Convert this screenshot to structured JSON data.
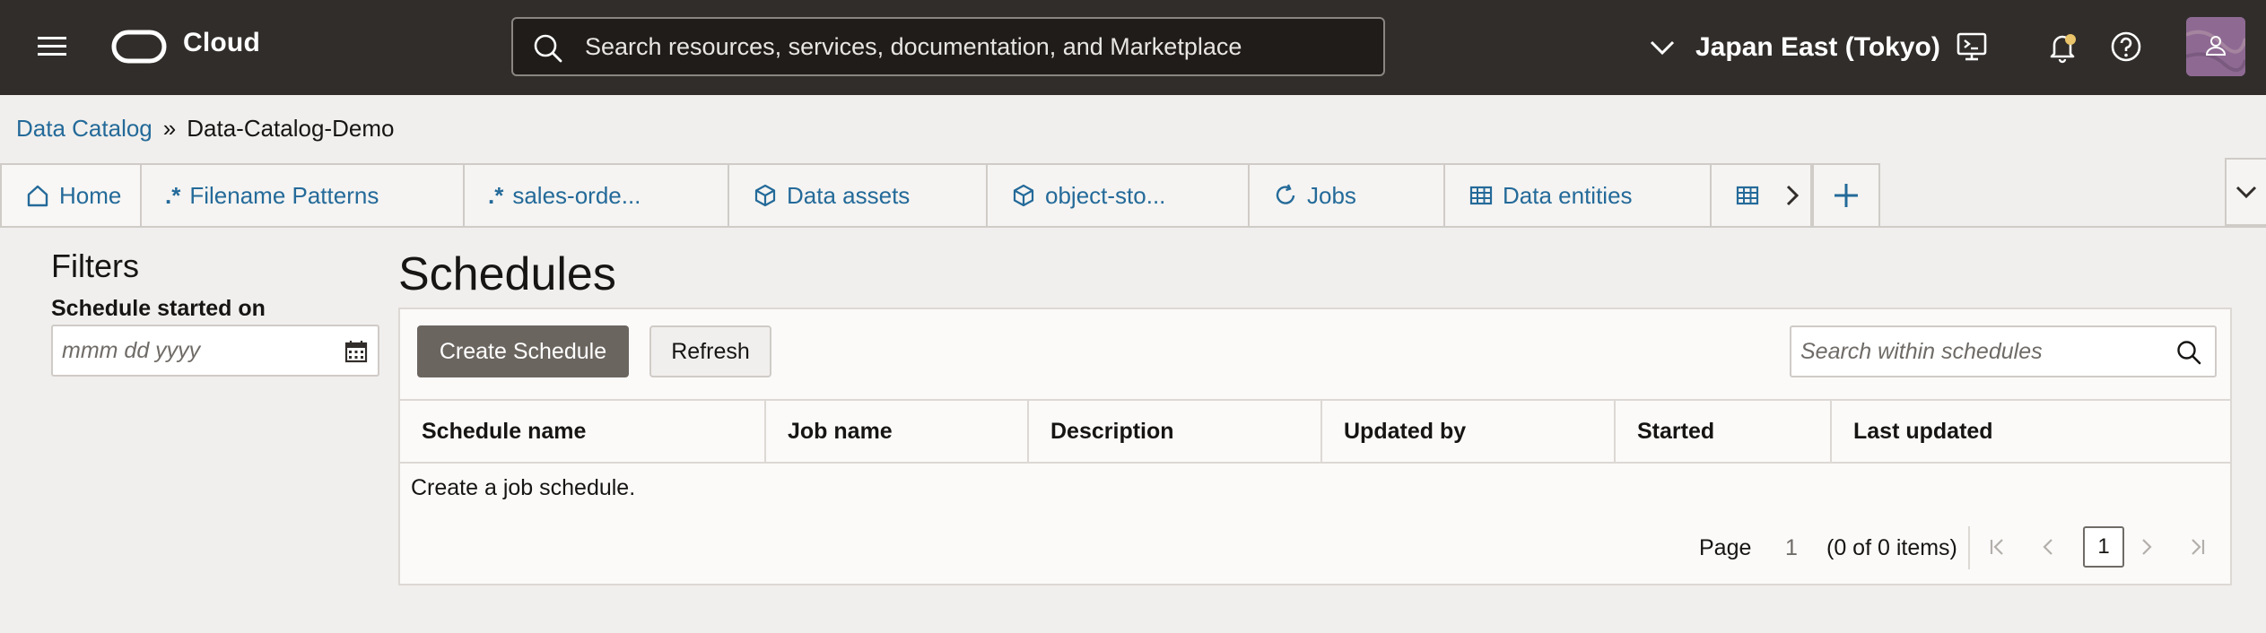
{
  "header": {
    "brand": "Cloud",
    "search_placeholder": "Search resources, services, documentation, and Marketplace",
    "region": "Japan East (Tokyo)",
    "icons": [
      "menu-icon",
      "oracle-logo",
      "search-icon",
      "chevron-down-icon",
      "cloud-shell-icon",
      "bell-icon",
      "help-icon",
      "user-icon"
    ]
  },
  "breadcrumb": {
    "parent": "Data Catalog",
    "separator": "»",
    "current": "Data-Catalog-Demo"
  },
  "tabs": [
    {
      "label": "Home",
      "icon": "home-icon"
    },
    {
      "label": "Filename Patterns",
      "icon": "regex-icon"
    },
    {
      "label": "sales-orde...",
      "icon": "regex-icon"
    },
    {
      "label": "Data assets",
      "icon": "cube-icon"
    },
    {
      "label": "object-sto...",
      "icon": "cube-icon"
    },
    {
      "label": "Jobs",
      "icon": "refresh-icon"
    },
    {
      "label": "Data entities",
      "icon": "table-icon"
    },
    {
      "label": "",
      "icon": "table-icon"
    }
  ],
  "filters": {
    "title": "Filters",
    "schedule_started_label": "Schedule started on",
    "date_placeholder": "mmm dd yyyy"
  },
  "main": {
    "title": "Schedules",
    "create_button": "Create Schedule",
    "refresh_button": "Refresh",
    "search_placeholder": "Search within schedules",
    "columns": [
      "Schedule name",
      "Job name",
      "Description",
      "Updated by",
      "Started",
      "Last updated"
    ],
    "empty_message": "Create a job schedule.",
    "pagination": {
      "page_label": "Page",
      "page_number": "1",
      "count_text": "(0 of 0 items)",
      "current_page": "1"
    }
  },
  "colors": {
    "header_bg": "#312d2a",
    "link": "#246a99",
    "primary_button": "#6b6560",
    "page_bg": "#f1efed"
  }
}
